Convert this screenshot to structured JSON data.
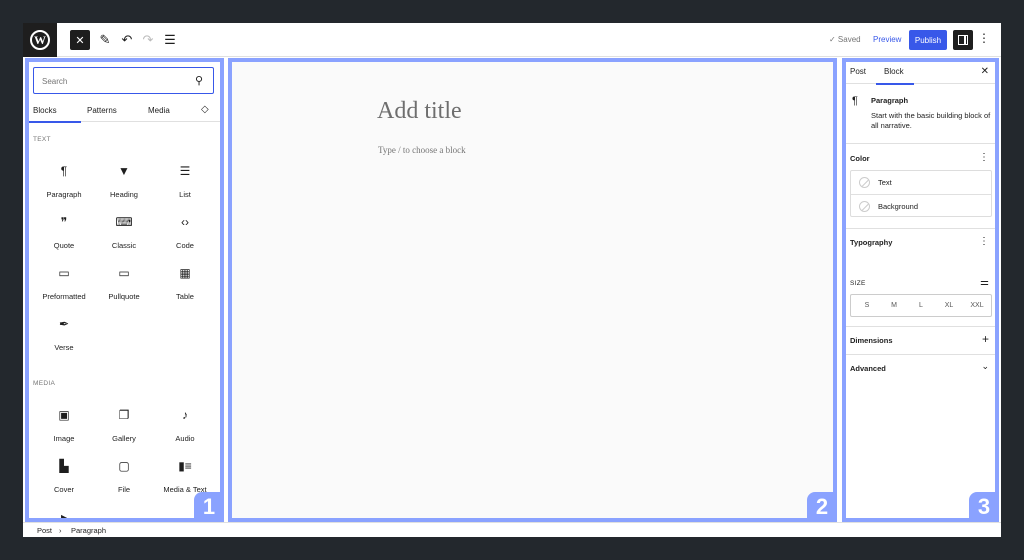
{
  "topbar": {
    "logo": "W",
    "close_icon": "✕",
    "pen_icon": "✎",
    "undo_icon": "↶",
    "redo_icon": "↷",
    "list_icon": "☰",
    "saved_label": "✓ Saved",
    "preview_label": "Preview",
    "publish_label": "Publish",
    "more_icon": "⋮"
  },
  "inserter": {
    "search_placeholder": "Search",
    "search_icon": "⚲",
    "tabs": [
      {
        "label": "Blocks"
      },
      {
        "label": "Patterns"
      },
      {
        "label": "Media"
      },
      {
        "label": "◇"
      }
    ],
    "sections": [
      {
        "label": "TEXT",
        "blocks": [
          {
            "label": "Paragraph",
            "glyph": "¶"
          },
          {
            "label": "Heading",
            "glyph": "▼"
          },
          {
            "label": "List",
            "glyph": "☰"
          },
          {
            "label": "Quote",
            "glyph": "❞"
          },
          {
            "label": "Classic",
            "glyph": "⌨"
          },
          {
            "label": "Code",
            "glyph": "‹›"
          },
          {
            "label": "Preformatted",
            "glyph": "▭"
          },
          {
            "label": "Pullquote",
            "glyph": "▭"
          },
          {
            "label": "Table",
            "glyph": "▦"
          },
          {
            "label": "Verse",
            "glyph": "✒"
          }
        ]
      },
      {
        "label": "MEDIA",
        "blocks": [
          {
            "label": "Image",
            "glyph": "▣"
          },
          {
            "label": "Gallery",
            "glyph": "❐"
          },
          {
            "label": "Audio",
            "glyph": "♪"
          },
          {
            "label": "Cover",
            "glyph": "▙"
          },
          {
            "label": "File",
            "glyph": "▢"
          },
          {
            "label": "Media & Text",
            "glyph": "▮≡"
          },
          {
            "label": "",
            "glyph": "▸"
          }
        ]
      }
    ]
  },
  "canvas": {
    "title_placeholder": "Add title",
    "block_hint": "Type / to choose a block"
  },
  "sidebar": {
    "tabs": [
      {
        "label": "Post"
      },
      {
        "label": "Block"
      }
    ],
    "close_icon": "✕",
    "block": {
      "icon": "¶",
      "name": "Paragraph",
      "description": "Start with the basic building block of all narrative."
    },
    "color": {
      "title": "Color",
      "items": [
        {
          "label": "Text"
        },
        {
          "label": "Background"
        }
      ]
    },
    "typography": {
      "title": "Typography",
      "size_label": "SIZE",
      "size_options": [
        "S",
        "M",
        "L",
        "XL",
        "XXL"
      ]
    },
    "dimensions": {
      "title": "Dimensions",
      "icon": "+"
    },
    "advanced": {
      "title": "Advanced",
      "icon": "⌄"
    }
  },
  "badges": [
    "1",
    "2",
    "3"
  ],
  "footer": {
    "breadcrumb": [
      "Post",
      "Paragraph"
    ],
    "separator": "›"
  }
}
